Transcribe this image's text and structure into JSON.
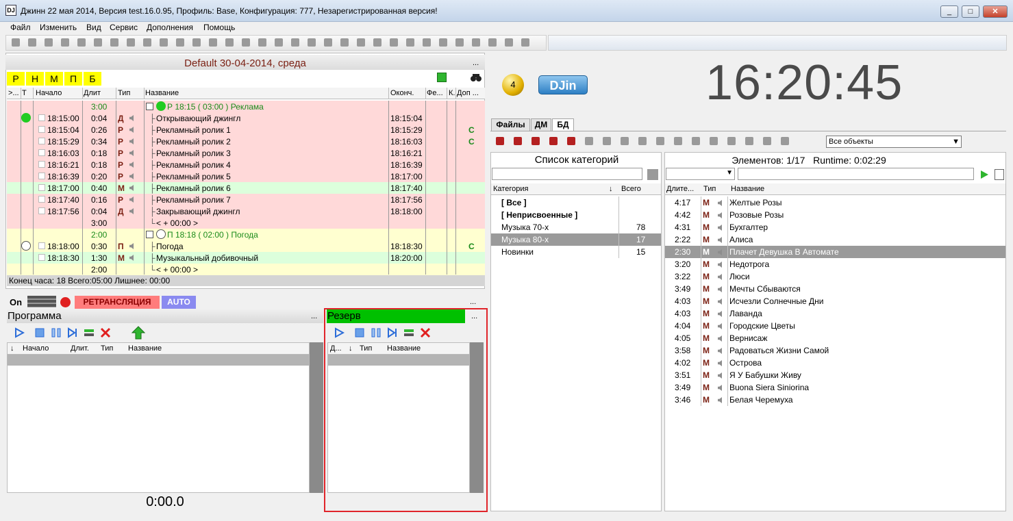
{
  "window": {
    "title": "Джинн 22 мая 2014, Версия test.16.0.95, Профиль: Base, Конфигурация: 777, Незарегистрированная версия!",
    "app_icon": "DJ",
    "min": "_",
    "max": "□",
    "close": "✕"
  },
  "menu": [
    "Файл",
    "Изменить",
    "Вид",
    "Сервис",
    "Дополнения",
    "Помощь"
  ],
  "schedule": {
    "title": "Default 30-04-2014, среда",
    "filters": [
      "Р",
      "Н",
      "М",
      "П",
      "Б"
    ],
    "columns": [
      ">...",
      "Т",
      "Начало",
      "Длит",
      "Тип",
      "Название",
      "Оконч.",
      "Фе...",
      "К.",
      "Доп ..."
    ],
    "rows": [
      {
        "bg": "#ffd9d9",
        "dur": "3:00",
        "name": "Р 18:15 ( 03:00 ) Реклама",
        "block": true,
        "icon": "green",
        "end": "",
        "extra": ""
      },
      {
        "bg": "#ffd9d9",
        "start": "18:15:00",
        "dur": "0:04",
        "type": "Д",
        "name": "Открывающий джингл",
        "end": "18:15:04",
        "extra": "",
        "ind": "green-dot"
      },
      {
        "bg": "#ffd9d9",
        "start": "18:15:04",
        "dur": "0:26",
        "type": "Р",
        "name": "Рекламный ролик 1",
        "end": "18:15:29",
        "extra": "С"
      },
      {
        "bg": "#ffd9d9",
        "start": "18:15:29",
        "dur": "0:34",
        "type": "Р",
        "name": "Рекламный ролик 2",
        "end": "18:16:03",
        "extra": "С"
      },
      {
        "bg": "#ffd9d9",
        "start": "18:16:03",
        "dur": "0:18",
        "type": "Р",
        "name": "Рекламный ролик 3",
        "end": "18:16:21",
        "extra": ""
      },
      {
        "bg": "#ffd9d9",
        "start": "18:16:21",
        "dur": "0:18",
        "type": "Р",
        "name": "Рекламный ролик 4",
        "end": "18:16:39",
        "extra": ""
      },
      {
        "bg": "#ffd9d9",
        "start": "18:16:39",
        "dur": "0:20",
        "type": "Р",
        "name": "Рекламный ролик 5",
        "end": "18:17:00",
        "extra": ""
      },
      {
        "bg": "#dcffdc",
        "start": "18:17:00",
        "dur": "0:40",
        "type": "М",
        "name": "Рекламный ролик 6",
        "end": "18:17:40",
        "extra": ""
      },
      {
        "bg": "#ffd9d9",
        "start": "18:17:40",
        "dur": "0:16",
        "type": "Р",
        "name": "Рекламный ролик 7",
        "end": "18:17:56",
        "extra": ""
      },
      {
        "bg": "#ffd9d9",
        "start": "18:17:56",
        "dur": "0:04",
        "type": "Д",
        "name": "Закрывающий джингл",
        "end": "18:18:00",
        "extra": ""
      },
      {
        "bg": "#ffd9d9",
        "dur": "3:00",
        "name": "< + 00:00 >",
        "end": "",
        "extra": "",
        "last": true
      },
      {
        "bg": "#ffffd0",
        "dur": "2:00",
        "name": "П 18:18 ( 02:00 ) Погода",
        "block": true,
        "icon": "clock",
        "end": "",
        "extra": ""
      },
      {
        "bg": "#ffffd0",
        "start": "18:18:00",
        "dur": "0:30",
        "type": "П",
        "name": "Погода",
        "end": "18:18:30",
        "extra": "С",
        "ind": "clock"
      },
      {
        "bg": "#dcffdc",
        "start": "18:18:30",
        "dur": "1:30",
        "type": "М",
        "name": "Музыкальный добивочный",
        "end": "18:20:00",
        "extra": ""
      },
      {
        "bg": "#ffffd0",
        "dur": "2:00",
        "name": "< + 00:00 >",
        "end": "",
        "extra": "",
        "last": true
      }
    ],
    "footer": "Конец часа: 18 Всего:05:00 Лишнее: 00:00"
  },
  "status": {
    "on": "On",
    "relay": "РЕТРАНСЛЯЦИЯ",
    "auto": "AUTO",
    "more": "..."
  },
  "program": {
    "title": "Программа",
    "more": "...",
    "columns": [
      "Начало",
      "Длит.",
      "Тип",
      "Название"
    ],
    "time": "0:00.0"
  },
  "reserve": {
    "title": "Резерв",
    "more": "...",
    "columns": [
      "Д...",
      "Тип",
      "Название"
    ]
  },
  "clock": {
    "time": "16:20:45",
    "ball": "4",
    "logo": "DJin"
  },
  "tabs": [
    "Файлы",
    "ДМ",
    "БД"
  ],
  "db": {
    "filter_select": "Все объекты",
    "categories_title": "Список категорий",
    "cat_columns": [
      "Категория",
      "Всего"
    ],
    "categories": [
      {
        "name": "[ Все ]",
        "count": "",
        "bold": true
      },
      {
        "name": "[ Неприсвоенные ]",
        "count": "",
        "bold": true
      },
      {
        "name": "Музыка 70-х",
        "count": "78"
      },
      {
        "name": "Музыка 80-х",
        "count": "17",
        "selected": true
      },
      {
        "name": "Новинки",
        "count": "15"
      }
    ],
    "elements_label": "Элементов: 1/17",
    "runtime_label": "Runtime: 0:02:29",
    "el_columns": [
      "Длите...",
      "Тип",
      "Название"
    ],
    "elements": [
      {
        "dur": "4:17",
        "name": "Желтые Розы"
      },
      {
        "dur": "4:42",
        "name": "Розовые Розы"
      },
      {
        "dur": "4:31",
        "name": "Бухгалтер"
      },
      {
        "dur": "2:22",
        "name": "Алиса"
      },
      {
        "dur": "2:30",
        "name": "Плачет Девушка В Автомате",
        "selected": true
      },
      {
        "dur": "3:20",
        "name": "Недотрога"
      },
      {
        "dur": "3:22",
        "name": "Люси"
      },
      {
        "dur": "3:49",
        "name": "Мечты Сбываются"
      },
      {
        "dur": "4:03",
        "name": "Исчезли Солнечные Дни"
      },
      {
        "dur": "4:03",
        "name": "Лаванда"
      },
      {
        "dur": "4:04",
        "name": "Городские Цветы"
      },
      {
        "dur": "4:05",
        "name": "Вернисаж"
      },
      {
        "dur": "3:58",
        "name": "Радоваться Жизни Самой"
      },
      {
        "dur": "4:02",
        "name": "Острова"
      },
      {
        "dur": "3:51",
        "name": "Я У Бабушки Живу"
      },
      {
        "dur": "3:49",
        "name": "Buona Siera Siniorina"
      },
      {
        "dur": "3:46",
        "name": "Белая Черемуха"
      }
    ]
  },
  "colors": {
    "highlight_border": "#e0242a",
    "reserve_header": "#00c000",
    "relay": "#ff7c7c",
    "auto": "#8a8af0",
    "filter_btn": "#ffff00"
  }
}
